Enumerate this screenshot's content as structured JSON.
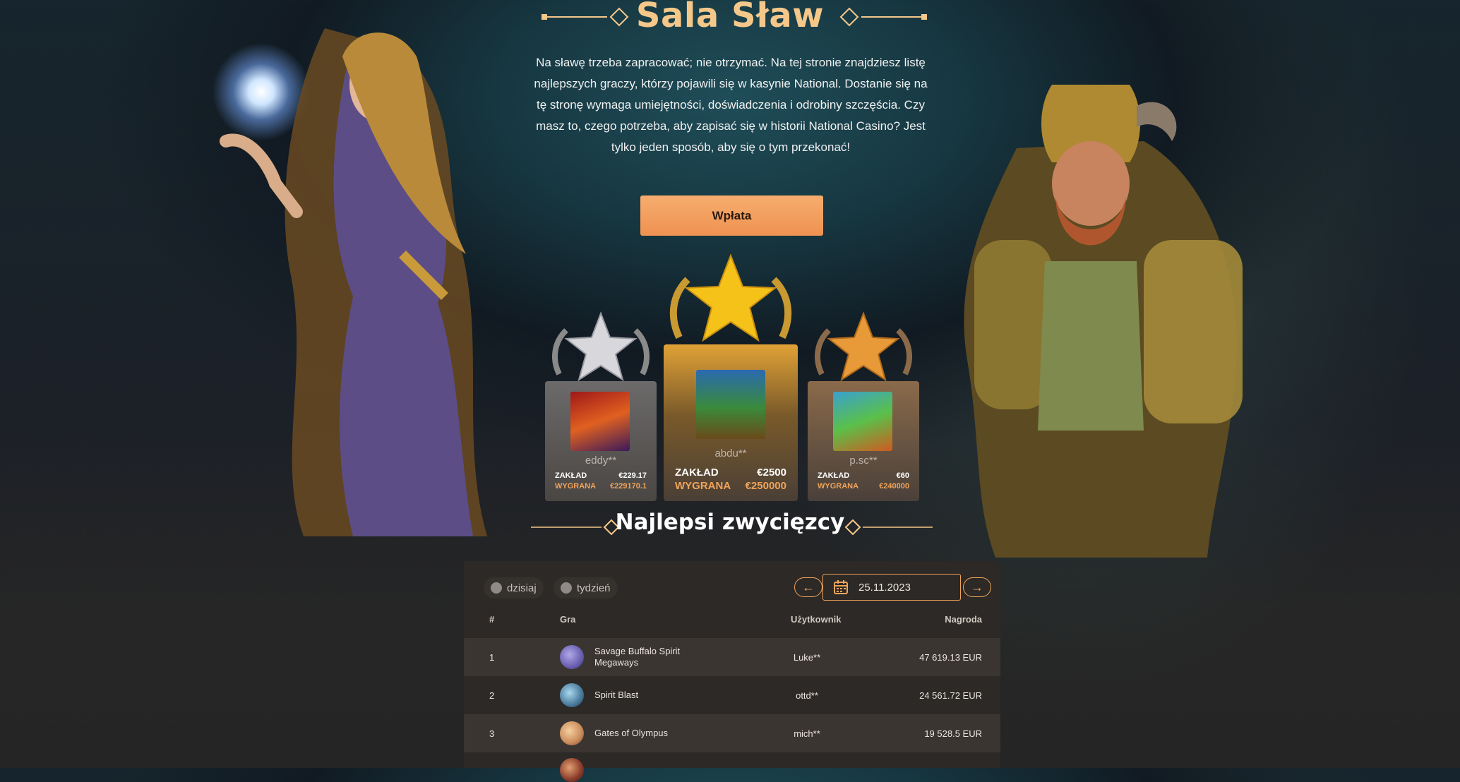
{
  "header": {
    "title": "Sala Sław",
    "intro": "Na sławę trzeba zapracować; nie otrzymać. Na tej stronie znajdziesz listę najlepszych graczy, którzy pojawili się w kasynie National. Dostanie się na tę stronę wymaga umiejętności, doświadczenia i odrobiny szczęścia. Czy masz to, czego potrzeba, aby zapisać się w historii National Casino? Jest tylko jeden sposób, aby się o tym przekonać!",
    "deposit_label": "Wpłata"
  },
  "podium": {
    "first": {
      "user": "abdu**",
      "bet_label": "ZAKŁAD",
      "bet": "€2500",
      "win_label": "WYGRANA",
      "win": "€250000",
      "game_icon": "big-bass-thumb"
    },
    "second": {
      "user": "eddy**",
      "bet_label": "ZAKŁAD",
      "bet": "€229.17",
      "win_label": "WYGRANA",
      "win": "€229170.1",
      "game_icon": "caishens-fortune-thumb"
    },
    "third": {
      "user": "p.sc**",
      "bet_label": "ZAKŁAD",
      "bet": "€60",
      "win_label": "WYGRANA",
      "win": "€240000",
      "game_icon": "wanted-thumb"
    }
  },
  "winners": {
    "heading": "Najlepsi zwycięzcy",
    "filters": {
      "today": "dzisiaj",
      "week": "tydzień"
    },
    "date": "25.11.2023",
    "columns": {
      "rank": "#",
      "game": "Gra",
      "user": "Użytkownik",
      "prize": "Nagroda"
    },
    "rows": [
      {
        "rank": "1",
        "game": "Savage Buffalo Spirit Megaways",
        "user": "Luke**",
        "prize": "47 619.13 EUR",
        "icon_color": "#6a5fb0"
      },
      {
        "rank": "2",
        "game": "Spirit Blast",
        "user": "ottd**",
        "prize": "24 561.72 EUR",
        "icon_color": "#4a7a9a"
      },
      {
        "rank": "3",
        "game": "Gates of Olympus",
        "user": "mich**",
        "prize": "19 528.5 EUR",
        "icon_color": "#c98a5a"
      }
    ]
  },
  "colors": {
    "accent": "#f0a45a",
    "title": "#f5c88a",
    "button": "#f39a5b"
  }
}
